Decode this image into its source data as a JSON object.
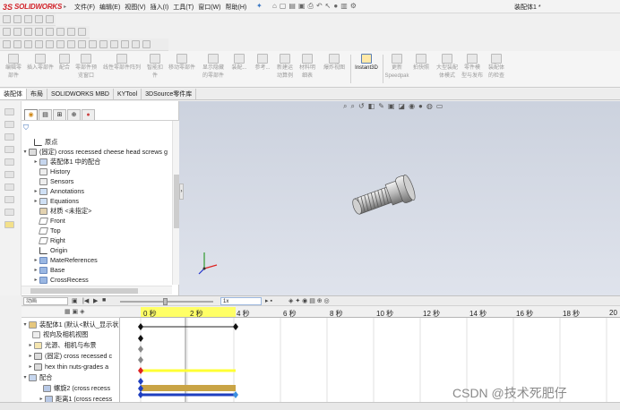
{
  "app": {
    "brand": "SOLIDWORKS",
    "brand_prefix": "3S",
    "doc_title": "装配体1 *"
  },
  "menu": [
    {
      "label": "文件(F)"
    },
    {
      "label": "编辑(E)"
    },
    {
      "label": "视图(V)"
    },
    {
      "label": "插入(I)"
    },
    {
      "label": "工具(T)"
    },
    {
      "label": "窗口(W)"
    },
    {
      "label": "帮助(H)"
    }
  ],
  "command_manager": [
    {
      "label": "编辑零\n部件"
    },
    {
      "label": "插入零部件"
    },
    {
      "label": "配合"
    },
    {
      "label": "零部件预\n览窗口"
    },
    {
      "label": "线性零部件阵列"
    },
    {
      "label": "智能扣\n件"
    },
    {
      "label": "移动零部件"
    },
    {
      "label": "显示隐藏\n的零部件"
    },
    {
      "label": "装配..."
    },
    {
      "label": "参考..."
    },
    {
      "label": "新建运\n动算例"
    },
    {
      "label": "材料明\n细表"
    },
    {
      "label": "爆炸视图"
    },
    {
      "label": "Instant3D"
    },
    {
      "label": "更新\nSpeedpak"
    },
    {
      "label": "拍快照"
    },
    {
      "label": "大型装配\n体模式"
    },
    {
      "label": "零件模\n型与发布"
    },
    {
      "label": "装配体\n的检查"
    }
  ],
  "tabs": [
    {
      "label": "装配体"
    },
    {
      "label": "布局"
    },
    {
      "label": "SOLIDWORKS MBD"
    },
    {
      "label": "KYTool"
    },
    {
      "label": "3DSource零件库"
    }
  ],
  "feature_tree": {
    "items": [
      {
        "label": "原点"
      },
      {
        "label": "(固定) cross recessed cheese head screws g"
      },
      {
        "label": "装配体1 中的配合"
      },
      {
        "label": "History"
      },
      {
        "label": "Sensors"
      },
      {
        "label": "Annotations"
      },
      {
        "label": "Equations"
      },
      {
        "label": "材质 <未指定>"
      },
      {
        "label": "Front"
      },
      {
        "label": "Top"
      },
      {
        "label": "Right"
      },
      {
        "label": "Origin"
      },
      {
        "label": "MateReferences"
      },
      {
        "label": "Base"
      },
      {
        "label": "CrossRecess"
      }
    ]
  },
  "motion": {
    "study_type": "动画",
    "speed": "1x",
    "ruler_labels": [
      "0 秒",
      "2 秒",
      "4 秒",
      "6 秒",
      "8 秒",
      "10 秒",
      "12 秒",
      "14 秒",
      "16 秒",
      "18 秒",
      "20"
    ],
    "tree": [
      {
        "label": "装配体1 (默认<默认_显示状"
      },
      {
        "label": "视向及相机视图"
      },
      {
        "label": "光源、相机与布景"
      },
      {
        "label": "(固定) cross recessed c"
      },
      {
        "label": "hex thin nuts-grades a"
      },
      {
        "label": "配合"
      },
      {
        "label": "螺旋2 (cross recess"
      },
      {
        "label": "距离1 (cross recess"
      }
    ]
  },
  "watermark": "CSDN @技术死肥仔",
  "colors": {
    "accent": "#3a6db5",
    "key_blue": "#1f3fbf",
    "track_yellow": "#ffff33",
    "track_tan": "#c9a445",
    "brand": "#d2232a"
  }
}
